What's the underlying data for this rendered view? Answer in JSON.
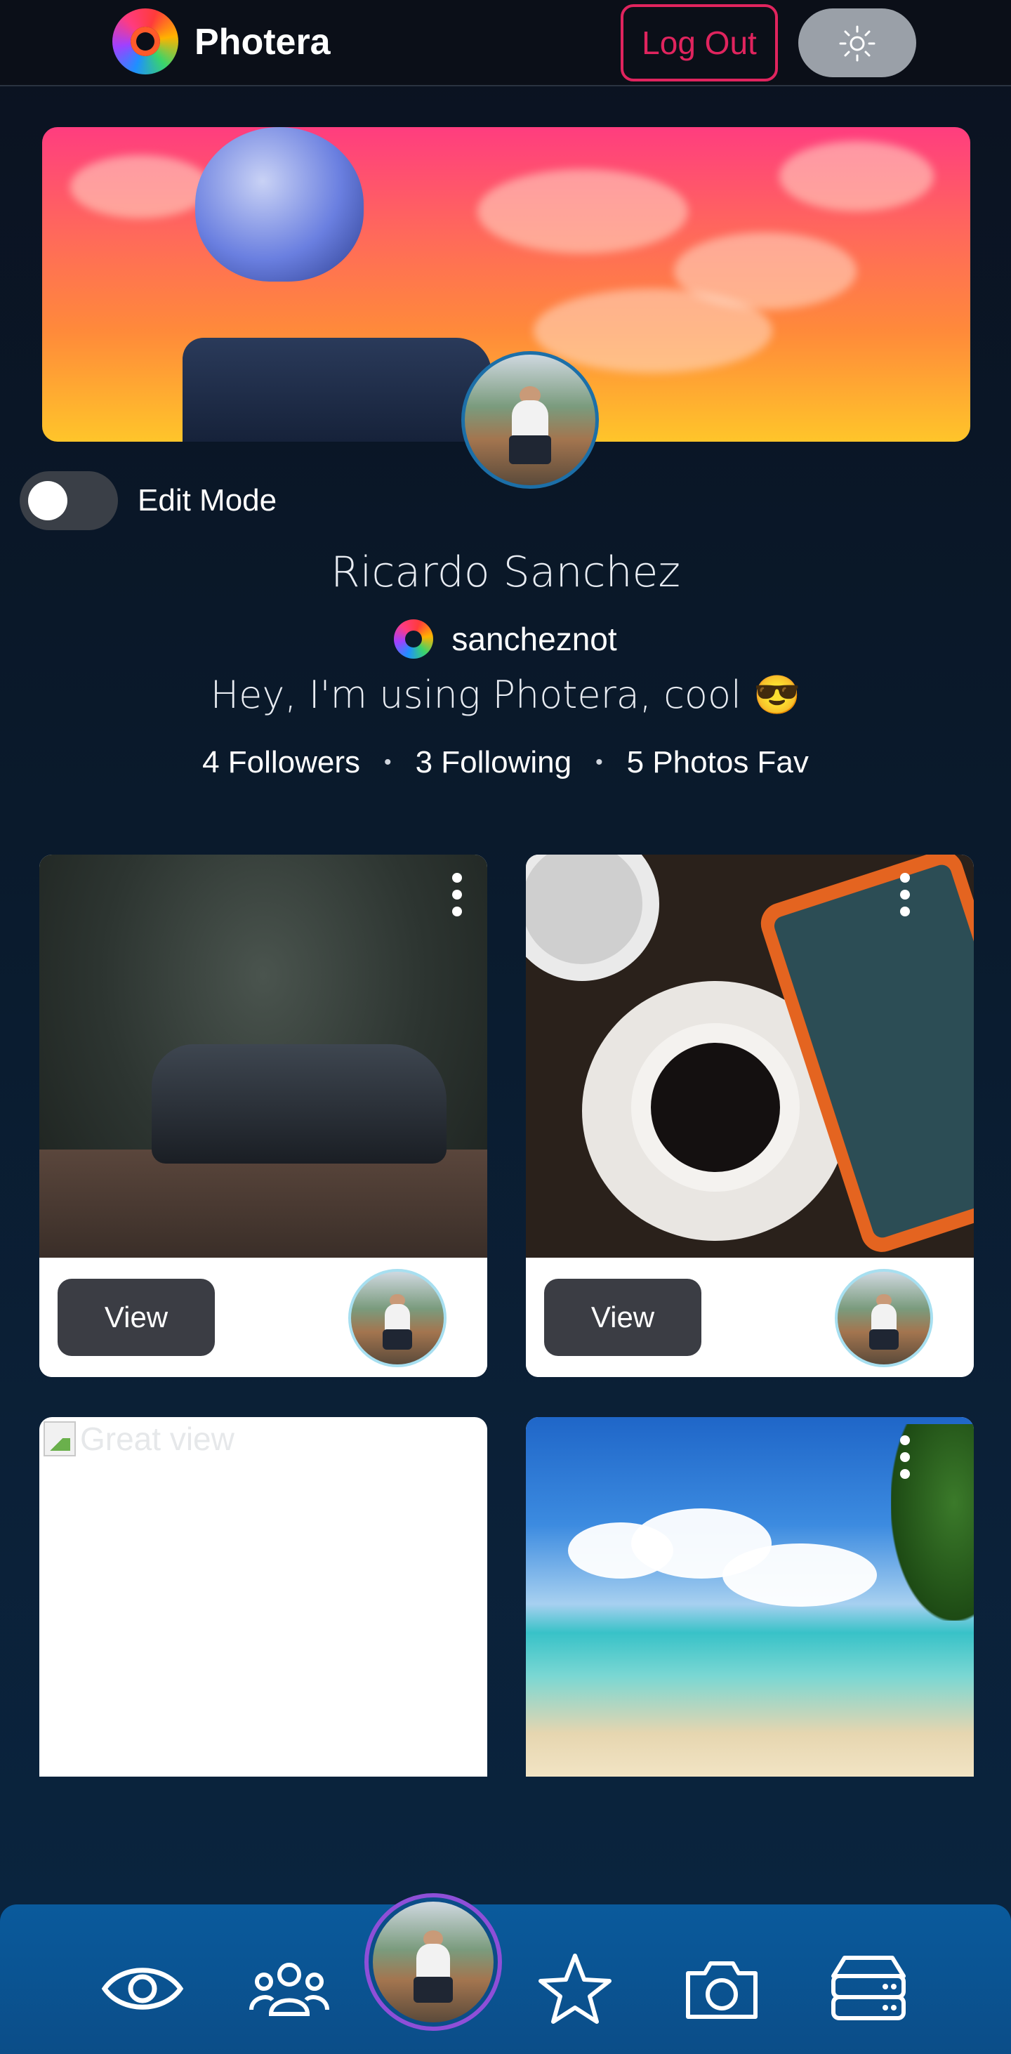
{
  "header": {
    "app_name": "Photera",
    "logout_label": "Log Out",
    "theme_toggle_icon": "sun-icon"
  },
  "profile": {
    "edit_mode_label": "Edit Mode",
    "edit_mode_on": false,
    "name": "Ricardo Sanchez",
    "username": "sancheznot",
    "bio": "Hey, I'm using Photera, cool 😎",
    "stats": {
      "followers": "4 Followers",
      "following": "3 Following",
      "favs": "5 Photos Fav"
    }
  },
  "cards": [
    {
      "view_label": "View",
      "kebab_icon": "more-vertical-icon"
    },
    {
      "view_label": "View",
      "kebab_icon": "more-vertical-icon"
    },
    {
      "broken_alt": "Great view"
    },
    {
      "kebab_icon": "more-vertical-icon"
    }
  ],
  "bottom_nav": {
    "items": [
      "eye-icon",
      "users-icon",
      "profile-avatar",
      "star-icon",
      "camera-icon",
      "database-icon"
    ]
  },
  "colors": {
    "accent_logout": "#e0245e",
    "nav_bg": "#0b4d88",
    "avatar_ring": "#8e4fd8"
  }
}
